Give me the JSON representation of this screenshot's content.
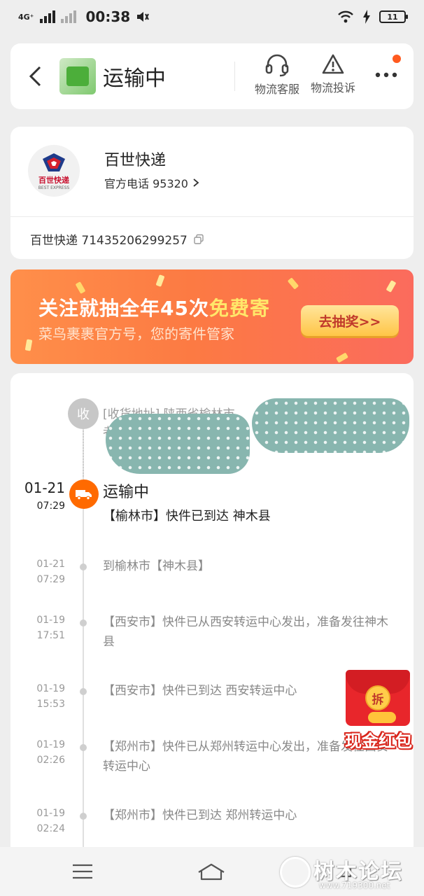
{
  "status_bar": {
    "network": "4G⁺",
    "time": "00:38",
    "battery": "11"
  },
  "header": {
    "title": "运输中",
    "actions": [
      {
        "label": "物流客服",
        "icon": "headset-icon"
      },
      {
        "label": "物流投诉",
        "icon": "warning-icon"
      }
    ],
    "more_icon": "more-dots-icon"
  },
  "company": {
    "logo_text": "百世快递",
    "logo_en": "BEST EXPRESS",
    "name": "百世快递",
    "phone": "官方电话 95320",
    "tracking": "百世快递 71435206299257"
  },
  "banner": {
    "headline_prefix": "关注就抽全年45次",
    "headline_highlight": "免费寄",
    "subline": "菜鸟裹裹官方号，您的寄件管家",
    "button": "去抽奖>>"
  },
  "timeline": {
    "receiver": {
      "badge": "收",
      "text": "[收货地址] 陕西省榆林市",
      "text_line2": "者"
    },
    "current": {
      "date": "01-21",
      "time": "07:29",
      "status": "运输中",
      "text": "【榆林市】快件已到达 神木县"
    },
    "events": [
      {
        "date": "01-21",
        "time": "07:29",
        "text": "到榆林市【神木县】"
      },
      {
        "date": "01-19",
        "time": "17:51",
        "text": "【西安市】快件已从西安转运中心发出，准备发往神木县"
      },
      {
        "date": "01-19",
        "time": "15:53",
        "text": "【西安市】快件已到达 西安转运中心"
      },
      {
        "date": "01-19",
        "time": "02:26",
        "text": "【郑州市】快件已从郑州转运中心发出，准备发往西安转运中心"
      },
      {
        "date": "01-19",
        "time": "02:24",
        "text": "【郑州市】快件已到达 郑州转运中心"
      }
    ]
  },
  "red_packet": {
    "seal": "拆",
    "label": "现金红包"
  },
  "watermark": {
    "text": "树木论坛",
    "url": "www.719300.net"
  },
  "colors": {
    "accent": "#ff6a00",
    "banner_start": "#ff8f4a",
    "banner_end": "#fb6b5d"
  }
}
